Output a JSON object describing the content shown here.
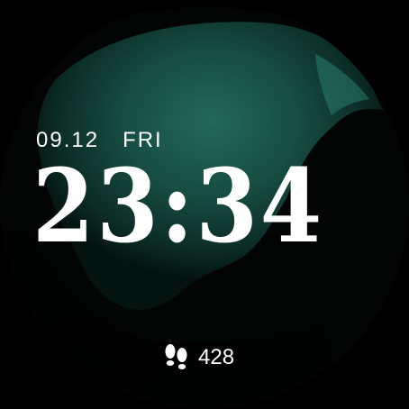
{
  "watchface": {
    "date": "09.12",
    "weekday": "FRI",
    "time": "23:34",
    "steps": {
      "icon": "footsteps-icon",
      "value": "428"
    },
    "colors": {
      "background": "#000000",
      "accent_green": "#1c5b4d",
      "text": "#ffffff"
    }
  }
}
